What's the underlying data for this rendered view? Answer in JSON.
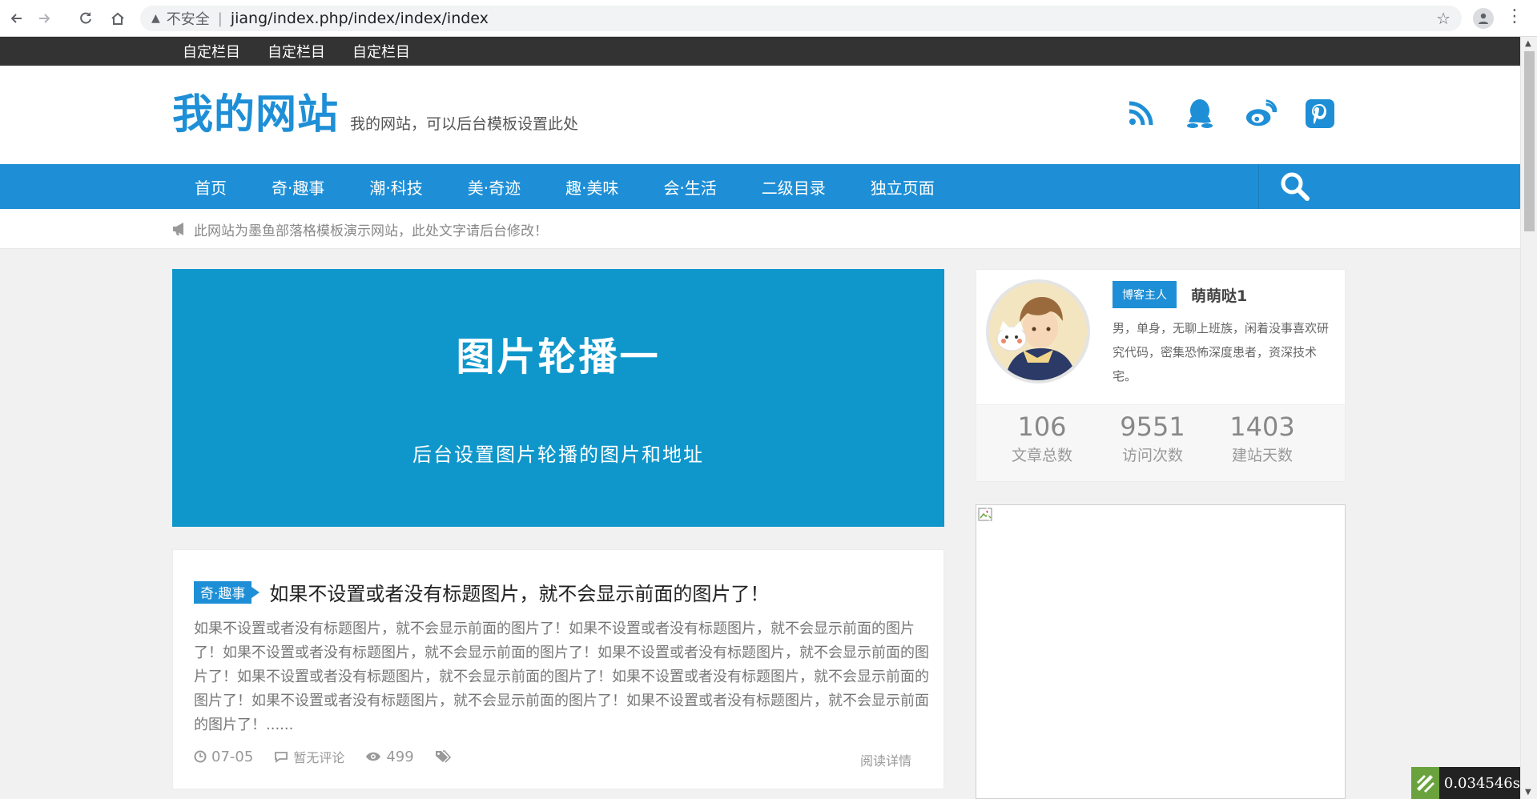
{
  "browser": {
    "insecure_label": "不安全",
    "url": "jiang/index.php/index/index/index"
  },
  "topbar": {
    "links": [
      "自定栏目",
      "自定栏目",
      "自定栏目"
    ]
  },
  "header": {
    "logo": "我的网站",
    "slogan": "我的网站，可以后台模板设置此处",
    "social_icons": [
      "rss-icon",
      "qq-icon",
      "weibo-icon",
      "pinterest-icon"
    ]
  },
  "nav": {
    "items": [
      "首页",
      "奇·趣事",
      "潮·科技",
      "美·奇迹",
      "趣·美味",
      "会·生活",
      "二级目录",
      "独立页面"
    ]
  },
  "notice": {
    "text": "此网站为墨鱼部落格模板演示网站，此处文字请后台修改！"
  },
  "banner": {
    "title": "图片轮播一",
    "subtitle": "后台设置图片轮播的图片和地址"
  },
  "post": {
    "category": "奇·趣事",
    "title": "如果不设置或者没有标题图片，就不会显示前面的图片了！",
    "excerpt": "如果不设置或者没有标题图片，就不会显示前面的图片了！如果不设置或者没有标题图片，就不会显示前面的图片了！如果不设置或者没有标题图片，就不会显示前面的图片了！如果不设置或者没有标题图片，就不会显示前面的图片了！如果不设置或者没有标题图片，就不会显示前面的图片了！如果不设置或者没有标题图片，就不会显示前面的图片了！如果不设置或者没有标题图片，就不会显示前面的图片了！如果不设置或者没有标题图片，就不会显示前面的图片了！......",
    "date": "07-05",
    "comments": "暂无评论",
    "views": "499",
    "read_more": "阅读详情"
  },
  "author": {
    "badge": "博客主人",
    "name": "萌萌哒1",
    "bio": "男，单身，无聊上班族，闲着没事喜欢研究代码，密集恐怖深度患者，资深技术宅。",
    "stats": [
      {
        "num": "106",
        "label": "文章总数"
      },
      {
        "num": "9551",
        "label": "访问次数"
      },
      {
        "num": "1403",
        "label": "建站天数"
      }
    ]
  },
  "timer": {
    "value": "0.034546s"
  },
  "colors": {
    "brand_blue": "#1e8fd6",
    "banner_blue": "#0f97cb",
    "topbar": "#333333"
  }
}
